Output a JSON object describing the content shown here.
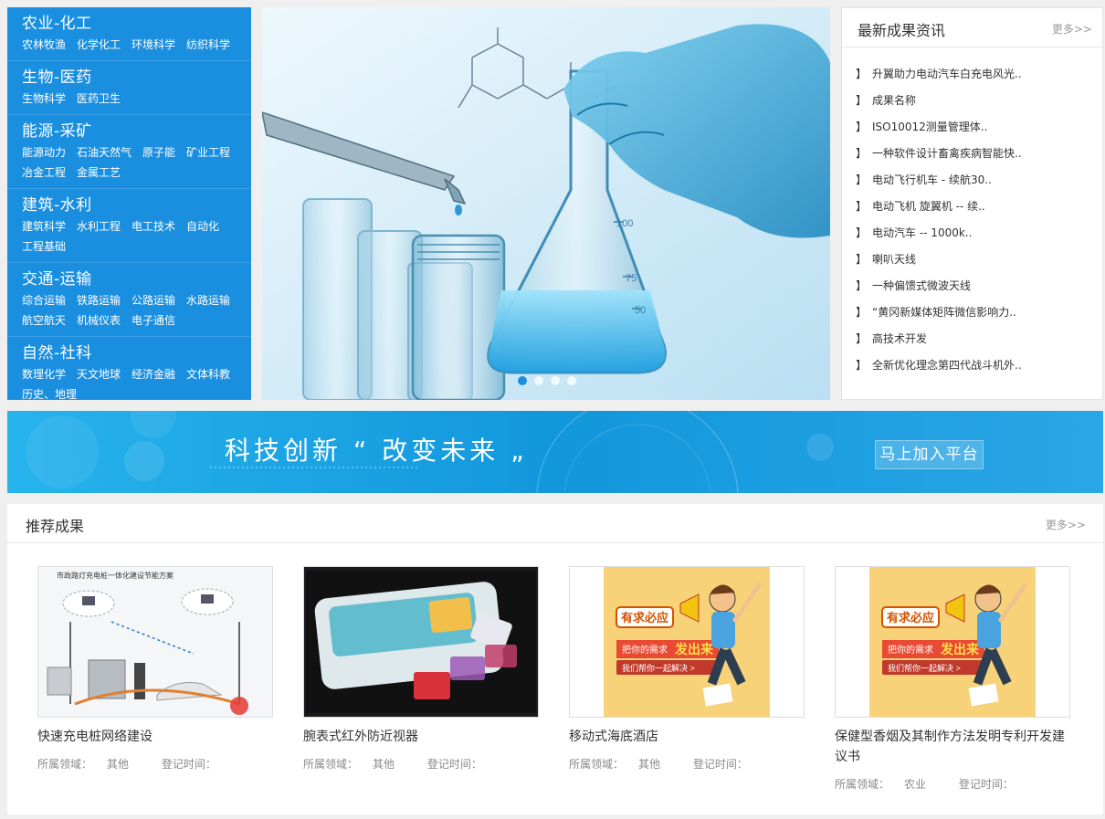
{
  "categories": [
    {
      "title": "农业-化工",
      "links": [
        "农林牧渔",
        "化学化工",
        "环境科学",
        "纺织科学"
      ]
    },
    {
      "title": "生物-医药",
      "links": [
        "生物科学",
        "医药卫生"
      ]
    },
    {
      "title": "能源-采矿",
      "links": [
        "能源动力",
        "石油天然气",
        "原子能",
        "矿业工程",
        "冶金工程",
        "金属工艺"
      ]
    },
    {
      "title": "建筑-水利",
      "links": [
        "建筑科学",
        "水利工程",
        "电工技术",
        "自动化",
        "工程基础"
      ]
    },
    {
      "title": "交通-运输",
      "links": [
        "综合运输",
        "铁路运输",
        "公路运输",
        "水路运输",
        "航空航天",
        "机械仪表",
        "电子通信"
      ]
    },
    {
      "title": "自然-社科",
      "links": [
        "数理化学",
        "天文地球",
        "经济金融",
        "文体科教",
        "历史、地理"
      ]
    }
  ],
  "hero": {
    "slide_count": 4,
    "active_slide": 1,
    "flask_marks": [
      "100",
      "75",
      "50"
    ]
  },
  "news": {
    "title": "最新成果资讯",
    "more": "更多>>",
    "bracket": "】",
    "items": [
      "升翼助力电动汽车白充电风光..",
      "成果名称",
      "ISO10012测量管理体..",
      "一种软件设计畜禽疾病智能快..",
      "电动飞行机车 - 续航30..",
      "电动飞机 旋翼机 -- 续..",
      "电动汽车 -- 1000k..",
      "喇叭天线",
      "一种偏馈式微波天线",
      "“黄冈新媒体矩阵微信影响力..",
      "高技术开发",
      "全新优化理念第四代战斗机外.."
    ]
  },
  "slogan": {
    "text": "科技创新 “ 改变未来 „",
    "button": "马上加入平台"
  },
  "recommend": {
    "title": "推荐成果",
    "more": "更多>>",
    "field_label": "所属领域：",
    "time_label": "登记时间：",
    "items": [
      {
        "name": "快速充电桩网络建设",
        "field": "其他",
        "image_caption": "市政路灯充电桩一体化建设节能方案"
      },
      {
        "name": "腕表式红外防近视器",
        "field": "其他"
      },
      {
        "name": "移动式海底酒店",
        "field": "其他",
        "poster": {
          "line1": "有求必应",
          "line2": "把你的需求",
          "line3": "发出来",
          "line4": "我们帮你一起解决 >"
        }
      },
      {
        "name": "保健型香烟及其制作方法发明专利开发建议书",
        "field": "农业",
        "poster": {
          "line1": "有求必应",
          "line2": "把你的需求",
          "line3": "发出来",
          "line4": "我们帮你一起解决 >"
        }
      }
    ]
  },
  "colors": {
    "primary": "#1a8fe0",
    "banner": "#15a0e0",
    "poster_bg": "#f8d278"
  }
}
